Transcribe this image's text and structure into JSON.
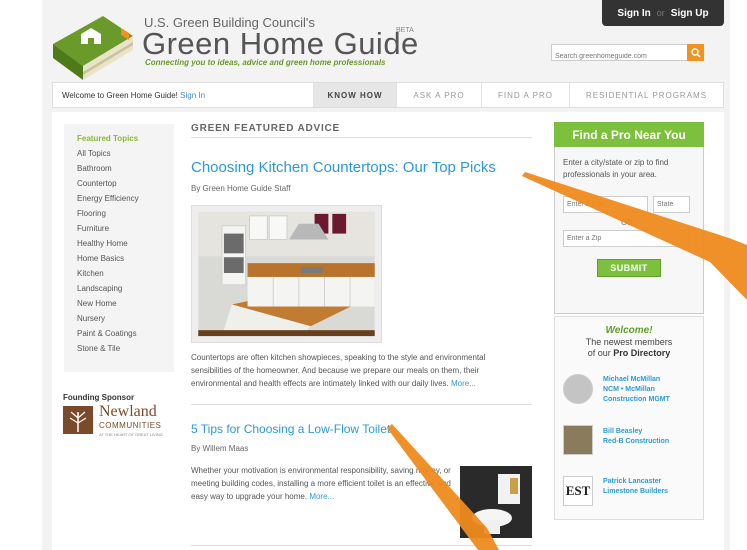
{
  "header": {
    "sign_in": "Sign In",
    "separator": "or",
    "sign_up": "Sign Up",
    "brand_top": "U.S. Green Building Council's",
    "brand_name": "Green Home Guide",
    "beta": "BETA",
    "tagline": "Connecting you to ideas, advice and green home professionals",
    "search_placeholder": "Search greenhomeguide.com"
  },
  "nav": {
    "welcome_text": "Welcome to Green Home Guide!",
    "welcome_link": "Sign In",
    "tabs": [
      {
        "label": "KNOW HOW",
        "active": true
      },
      {
        "label": "ASK A PRO",
        "active": false
      },
      {
        "label": "FIND A PRO",
        "active": false
      },
      {
        "label": "RESIDENTIAL PROGRAMS",
        "active": false
      }
    ]
  },
  "sidebar": {
    "heading": "Featured Topics",
    "items": [
      "All Topics",
      "Bathroom",
      "Countertop",
      "Energy Efficiency",
      "Flooring",
      "Furniture",
      "Healthy Home",
      "Home Basics",
      "Kitchen",
      "Landscaping",
      "New Home",
      "Nursery",
      "Paint & Coatings",
      "Stone & Tile"
    ],
    "sponsor_label": "Founding Sponsor",
    "sponsor_name": "Newland",
    "sponsor_sub": "COMMUNITIES",
    "sponsor_tiny": "AT THE HEART OF GREAT LIVING"
  },
  "main": {
    "section_title": "GREEN FEATURED ADVICE",
    "article1": {
      "title": "Choosing Kitchen Countertops: Our Top Picks",
      "byline": "By Green Home Guide Staff",
      "body": "Countertops are often kitchen showpieces, speaking to the style and environmental sensibilities of the homeowner. And because we prepare our meals on them, their environmental and health effects are intimately linked with our daily lives.",
      "more": "More..."
    },
    "article2": {
      "title": "5 Tips for Choosing a Low-Flow Toilet",
      "byline": "By Willem Maas",
      "body": "Whether your motivation is environmental responsibility, saving money, or meeting building codes, installing a more efficient toilet is an effective and easy way to upgrade your home.",
      "more": "More..."
    }
  },
  "findpro": {
    "heading": "Find a Pro Near You",
    "text": "Enter a city/state or zip to find professionals in your area.",
    "city_placeholder": "Enter a City",
    "state_placeholder": "State",
    "or": "OR",
    "zip_placeholder": "Enter a Zip",
    "submit": "SUBMIT"
  },
  "members": {
    "welcome": "Welcome!",
    "sub_line1": "The newest members",
    "sub_line2": "of our",
    "sub_bold": "Pro Directory",
    "list": [
      {
        "name1": "Michael McMillan",
        "name2": "NCM • McMillan",
        "name3": "Construction MGMT"
      },
      {
        "name1": "Bill Beasley",
        "name2": "Red-B Construction",
        "name3": ""
      },
      {
        "name1": "Patrick Lancaster",
        "name2": "Limestone Builders",
        "name3": ""
      }
    ],
    "logo3_text": "EST"
  },
  "colors": {
    "brand_green": "#7cc03e",
    "link_blue": "#2b9ad6",
    "accent_orange": "#f0921f"
  }
}
